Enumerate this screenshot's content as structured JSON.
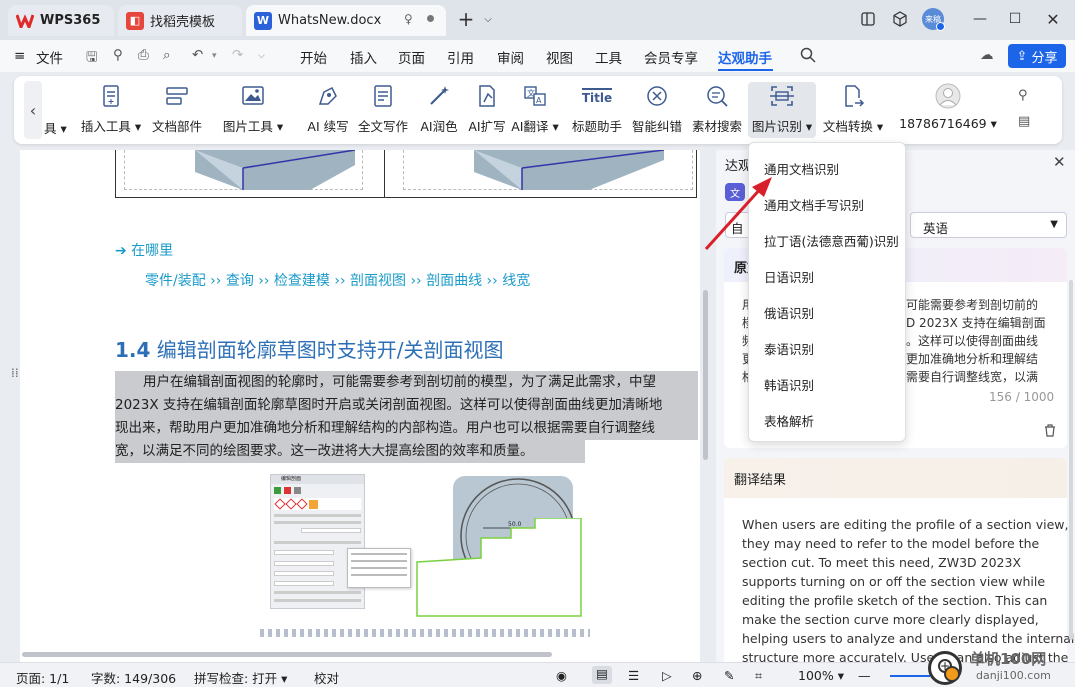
{
  "tabs": [
    {
      "label": "WPS365"
    },
    {
      "label": "找稻壳模板"
    },
    {
      "label": "WhatsNew.docx"
    }
  ],
  "user": {
    "avatar_text": "来稿"
  },
  "menu": {
    "file": "文件",
    "items": [
      "开始",
      "插入",
      "页面",
      "引用",
      "审阅",
      "视图",
      "工具",
      "会员专享",
      "达观助手"
    ],
    "share": "分享"
  },
  "ribbon": {
    "partial": "具",
    "items": [
      "插入工具",
      "文档部件",
      "图片工具",
      "AI 续写",
      "全文写作",
      "AI润色",
      "AI扩写",
      "AI翻译",
      "标题助手",
      "智能纠错",
      "素材搜索",
      "图片识别",
      "文档转换",
      "18786716469"
    ],
    "title_icon_text": "Title"
  },
  "document": {
    "where_label": "➔ 在哪里",
    "path": "零件/装配 ›› 查询 ›› 检查建模 ›› 剖面视图 ›› 剖面曲线 ›› 线宽",
    "heading_num": "1.4",
    "heading_text": "编辑剖面轮廓草图时支持开/关剖面视图",
    "lines": [
      "用户在编辑剖面视图的轮廓时，可能需要参考到剖切前的模型，为了满足此需求，中望",
      "2023X 支持在编辑剖面轮廓草图时开启或关闭剖面视图。这样可以使得剖面曲线更加清晰地",
      "现出来，帮助用户更加准确地分析和理解结构的内部构造。用户也可以根据需要自行调整线",
      "宽，以满足不同的绘图要求。这一改进将大大提高绘图的效率和质量。"
    ],
    "fig_dialog_title": "编辑剖面",
    "fig_dim": "50.0"
  },
  "panel": {
    "title": "达观",
    "lang_left": "自",
    "lang_right": "英语",
    "source_title": "原文",
    "source_lines_left": [
      "用",
      "楼",
      "频",
      "更",
      "格"
    ],
    "source_lines_right": [
      "可能需要参考到剖切前的",
      "D 2023X 支持在编辑剖面",
      "。这样可以使得剖面曲线",
      "更加准确地分析和理解结",
      "需要自行调整线宽，以满"
    ],
    "char_count": "156 / 1000",
    "result_title": "翻译结果",
    "result_lines": [
      "When users are editing the profile of a section view,",
      "they may need to refer to the model before the",
      "section cut. To meet this need, ZW3D 2023X",
      "supports turning on or off the section view while",
      "editing the profile sketch of the section. This can",
      "make the section curve more clearly displayed,",
      "helping users to analyze and understand the internal",
      "structure more accurately. Users can also adjust the"
    ]
  },
  "dropdown": {
    "items": [
      "通用文档识别",
      "通用文档手写识别",
      "拉丁语(法德意西葡)识别",
      "日语识别",
      "俄语识别",
      "泰语识别",
      "韩语识别",
      "表格解析"
    ]
  },
  "status": {
    "page": "页面: 1/1",
    "words": "字数: 149/306",
    "spell": "拼写检查: 打开",
    "proof": "校对",
    "zoom": "100%"
  },
  "watermark": {
    "text": "单机100网",
    "url": "danji100.com"
  },
  "colors": {
    "accent": "#1c64e8",
    "link": "#1a9bc9",
    "heading": "#2d6fb7",
    "arrow": "#d9202a"
  }
}
